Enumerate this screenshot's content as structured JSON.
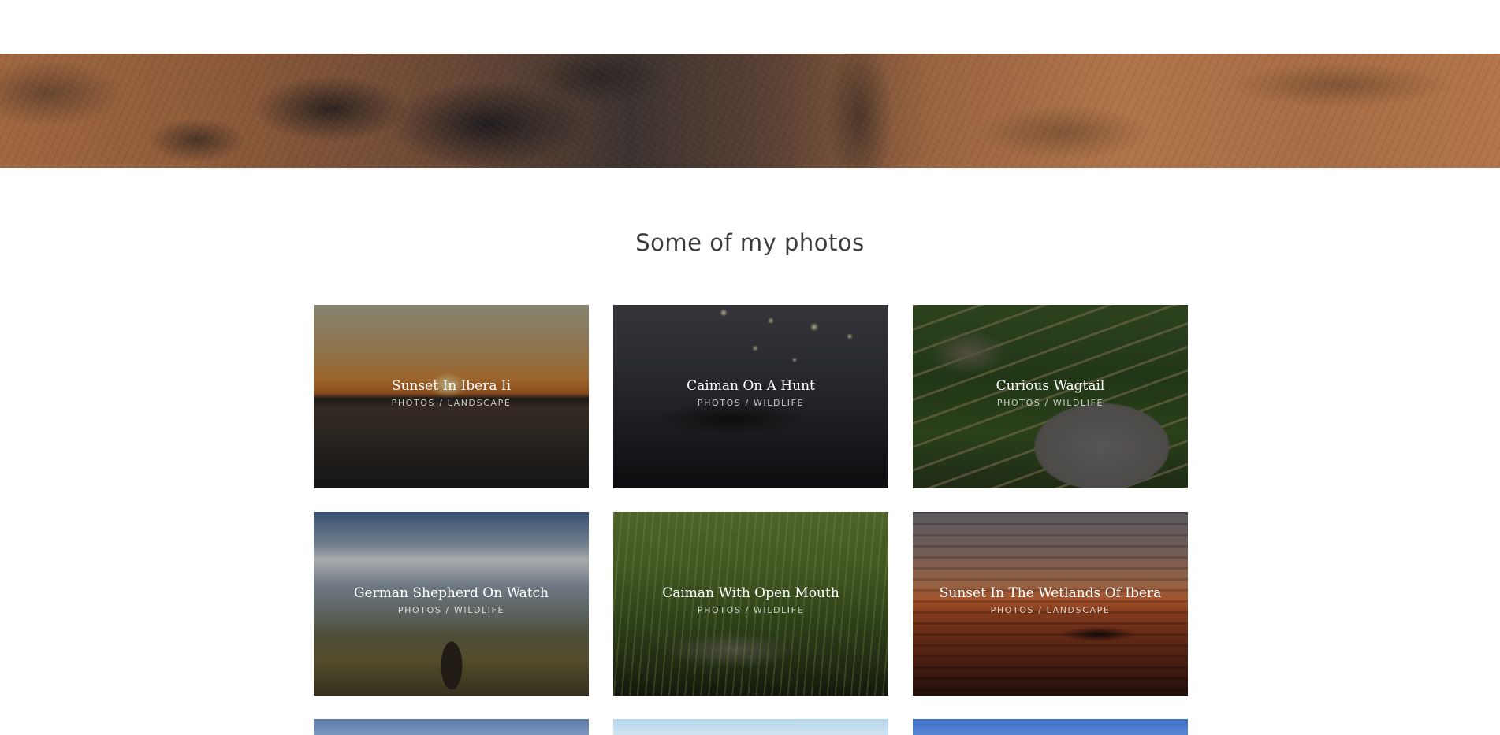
{
  "section": {
    "title": "Some of my photos"
  },
  "photos": [
    {
      "title": "Sunset In Ibera Ii",
      "category": "PHOTOS / LANDSCAPE"
    },
    {
      "title": "Caiman On A Hunt",
      "category": "PHOTOS / WILDLIFE"
    },
    {
      "title": "Curious Wagtail",
      "category": "PHOTOS / WILDLIFE"
    },
    {
      "title": "German Shepherd On Watch",
      "category": "PHOTOS / WILDLIFE"
    },
    {
      "title": "Caiman With Open Mouth",
      "category": "PHOTOS / WILDLIFE"
    },
    {
      "title": "Sunset In The Wetlands Of Ibera",
      "category": "PHOTOS / LANDSCAPE"
    }
  ]
}
